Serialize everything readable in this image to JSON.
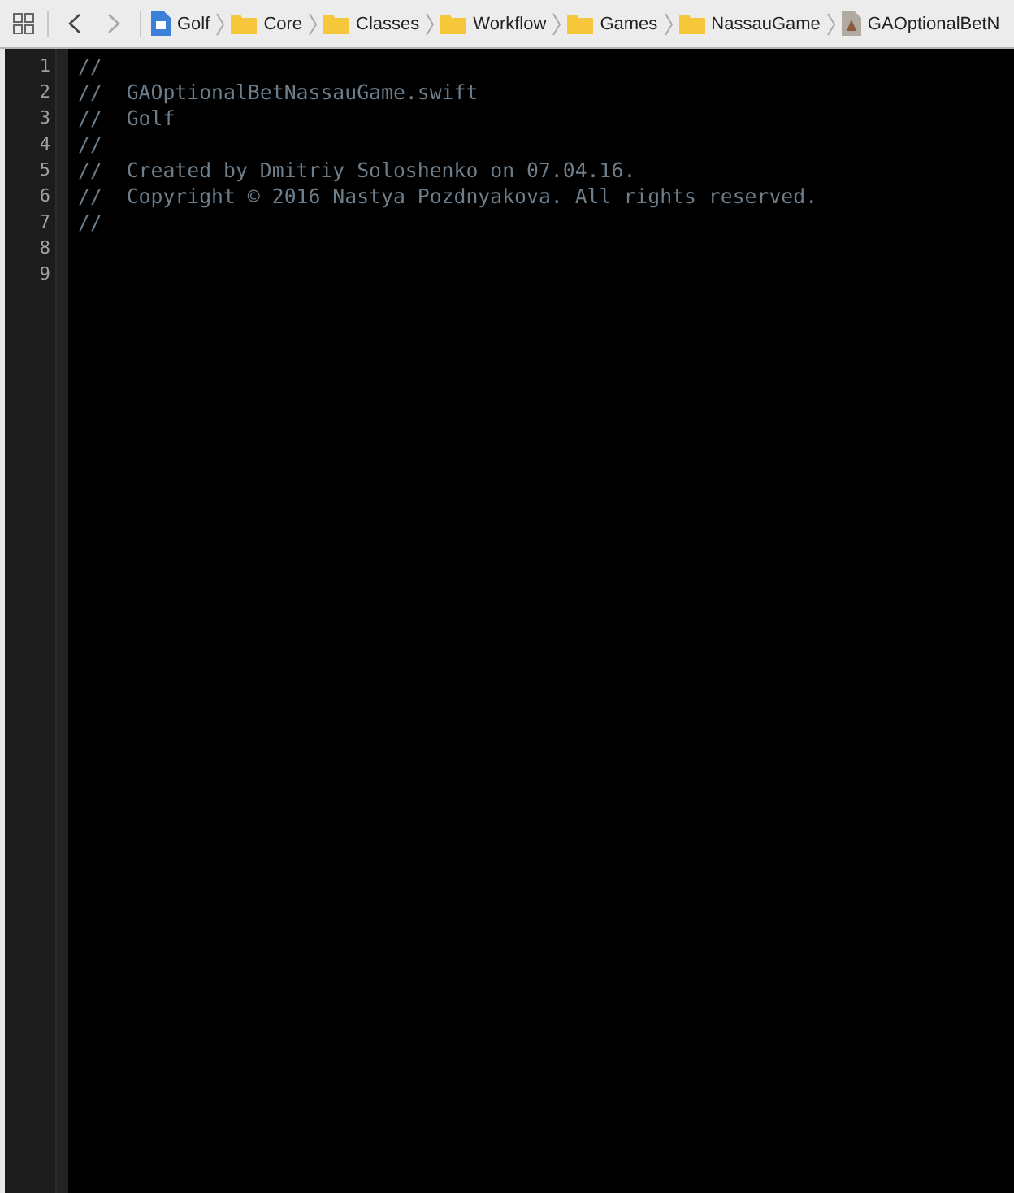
{
  "breadcrumb": [
    {
      "kind": "project",
      "label": "Golf"
    },
    {
      "kind": "folder",
      "label": "Core"
    },
    {
      "kind": "folder",
      "label": "Classes"
    },
    {
      "kind": "folder",
      "label": "Workflow"
    },
    {
      "kind": "folder",
      "label": "Games"
    },
    {
      "kind": "folder",
      "label": "NassauGame"
    },
    {
      "kind": "file",
      "label": "GAOptionalBetN"
    }
  ],
  "editor": {
    "lines": [
      {
        "number": "1",
        "text": "//"
      },
      {
        "number": "2",
        "text": "//  GAOptionalBetNassauGame.swift"
      },
      {
        "number": "3",
        "text": "//  Golf"
      },
      {
        "number": "4",
        "text": "//"
      },
      {
        "number": "5",
        "text": "//  Created by Dmitriy Soloshenko on 07.04.16."
      },
      {
        "number": "6",
        "text": "//  Copyright © 2016 Nastya Pozdnyakova. All rights reserved."
      },
      {
        "number": "7",
        "text": "//"
      },
      {
        "number": "8"
      },
      {
        "number": "9"
      }
    ]
  }
}
